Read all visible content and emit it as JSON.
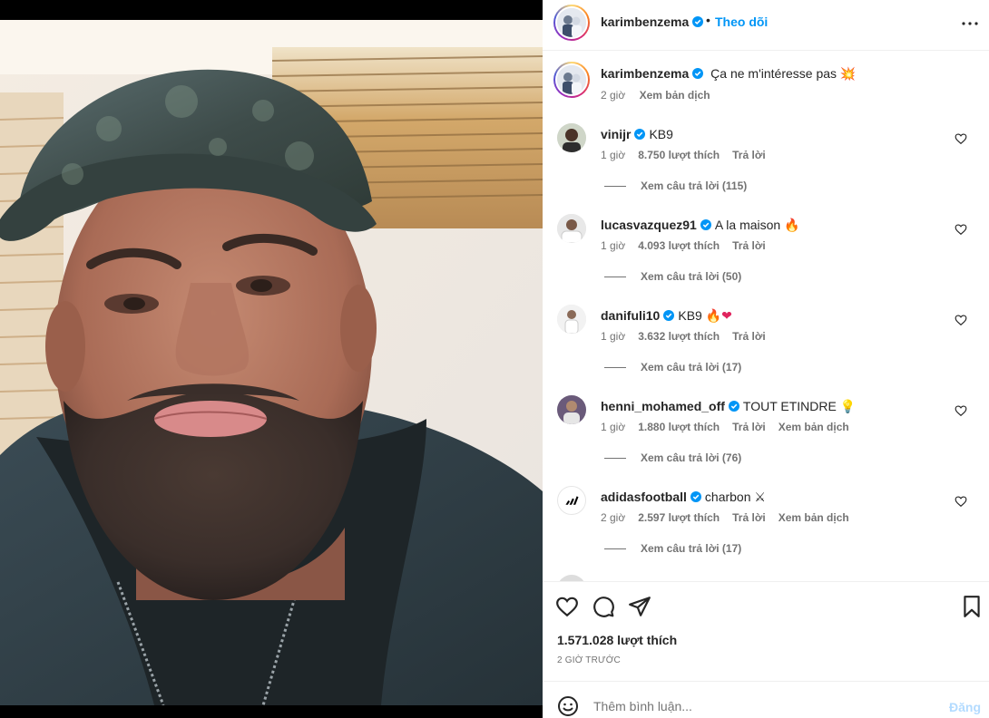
{
  "post": {
    "author": "karimbenzema",
    "follow_label": "Theo dõi",
    "separator": "•",
    "caption": "Ça ne m'intéresse pas",
    "caption_emoji": "💥",
    "caption_age": "2 giờ",
    "translate_label": "Xem bản dịch",
    "likes": "1.571.028 lượt thích",
    "timestamp": "2 GIỜ TRƯỚC"
  },
  "comments": [
    {
      "user": "vinijr",
      "text": "KB9",
      "emoji": "",
      "age": "1 giờ",
      "likes": "8.750 lượt thích",
      "reply": "Trả lời",
      "translate": "",
      "replies": "Xem câu trả lời (115)"
    },
    {
      "user": "lucasvazquez91",
      "text": "A la maison",
      "emoji": "🔥",
      "age": "1 giờ",
      "likes": "4.093 lượt thích",
      "reply": "Trả lời",
      "translate": "",
      "replies": "Xem câu trả lời (50)"
    },
    {
      "user": "danifuli10",
      "text": "KB9",
      "emoji": "🔥❤",
      "age": "1 giờ",
      "likes": "3.632 lượt thích",
      "reply": "Trả lời",
      "translate": "",
      "replies": "Xem câu trả lời (17)"
    },
    {
      "user": "henni_mohamed_off",
      "text": "TOUT ETINDRE",
      "emoji": "💡",
      "age": "1 giờ",
      "likes": "1.880 lượt thích",
      "reply": "Trả lời",
      "translate": "Xem bản dịch",
      "replies": "Xem câu trả lời (76)"
    },
    {
      "user": "adidasfootball",
      "text": "charbon",
      "emoji": "⚔",
      "age": "2 giờ",
      "likes": "2.597 lượt thích",
      "reply": "Trả lời",
      "translate": "Xem bản dịch",
      "replies": "Xem câu trả lời (17)"
    }
  ],
  "composer": {
    "placeholder": "Thêm bình luận...",
    "post_label": "Đăng"
  },
  "icons": {
    "verified": "verified-badge-icon",
    "more": "more-options-icon",
    "like": "heart-icon",
    "comment": "comment-icon",
    "share": "share-icon",
    "save": "bookmark-icon",
    "emoji": "emoji-icon"
  },
  "colors": {
    "accent": "#0095f6",
    "verified": "#0095f6",
    "muted": "#737373",
    "post_disabled": "#b3dbff"
  }
}
